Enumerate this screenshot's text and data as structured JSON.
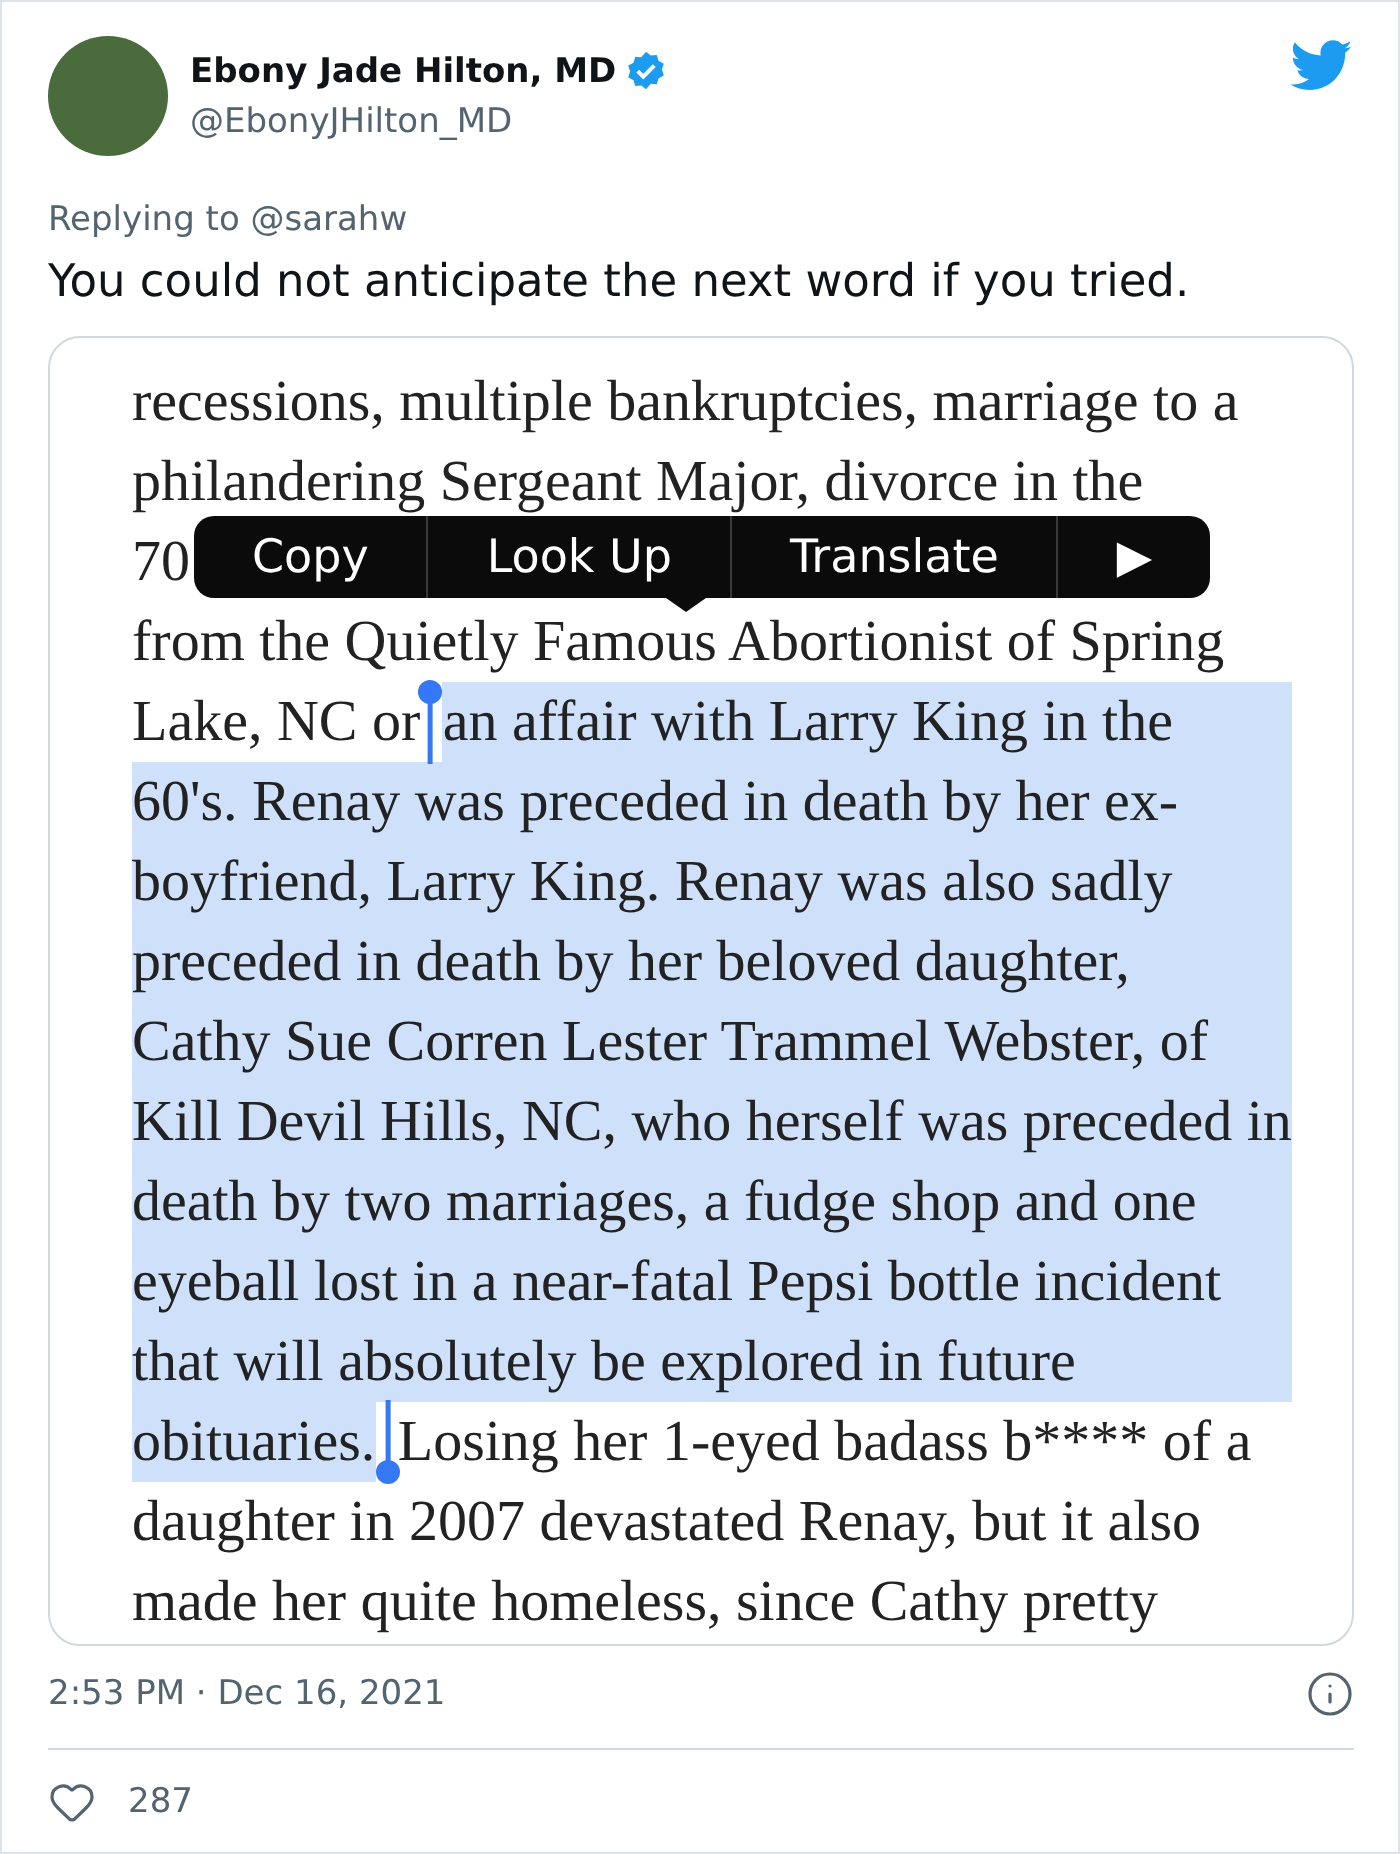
{
  "author": {
    "name": "Ebony Jade Hilton, MD",
    "handle": "@EbonyJHilton_MD",
    "verified": true
  },
  "reply_to": "Replying to @sarahw",
  "text": "You could not anticipate the next word if you tried.",
  "media": {
    "lines": [
      {
        "segments": [
          {
            "text": "recessions, multiple bankruptcies, marriage to a",
            "selected": false
          }
        ]
      },
      {
        "segments": [
          {
            "text": "philandering Sergeant Major, divorce in the",
            "selected": false
          }
        ]
      },
      {
        "segments": [
          {
            "text": "70",
            "selected": false
          }
        ]
      },
      {
        "segments": [
          {
            "text": "from the Quietly Famous Abortionist of Spring",
            "selected": false
          }
        ]
      },
      {
        "segments": [
          {
            "text": "Lake, NC or ",
            "selected": false
          },
          {
            "text": "an affair with Larry King in the",
            "selected": true
          }
        ]
      },
      {
        "segments": [
          {
            "text": "60's. Renay was preceded in death by her ex-",
            "selected": true
          }
        ]
      },
      {
        "segments": [
          {
            "text": "boyfriend, Larry King. Renay was also sadly",
            "selected": true
          }
        ]
      },
      {
        "segments": [
          {
            "text": "preceded in death by her beloved daughter,",
            "selected": true
          }
        ]
      },
      {
        "segments": [
          {
            "text": "Cathy Sue Corren Lester Trammel Webster, of",
            "selected": true
          }
        ]
      },
      {
        "segments": [
          {
            "text": "Kill Devil Hills, NC, who herself was preceded in",
            "selected": true
          }
        ]
      },
      {
        "segments": [
          {
            "text": "death by two marriages, a fudge shop and one",
            "selected": true
          }
        ]
      },
      {
        "segments": [
          {
            "text": "eyeball lost in a near-fatal Pepsi bottle incident",
            "selected": true
          }
        ]
      },
      {
        "segments": [
          {
            "text": "that will absolutely be explored in future",
            "selected": true
          }
        ]
      },
      {
        "segments": [
          {
            "text": "obituaries.",
            "selected": true
          },
          {
            "text": " Losing her 1-eyed badass b**** of a",
            "selected": false
          }
        ]
      },
      {
        "segments": [
          {
            "text": "daughter in 2007 devastated Renay, but it also",
            "selected": false
          }
        ]
      },
      {
        "segments": [
          {
            "text": "made her quite homeless, since Cathy pretty",
            "selected": false
          }
        ]
      }
    ],
    "context_menu": [
      "Copy",
      "Look Up",
      "Translate",
      "▶"
    ]
  },
  "timestamp": "2:53 PM · Dec 16, 2021",
  "likes": "287"
}
